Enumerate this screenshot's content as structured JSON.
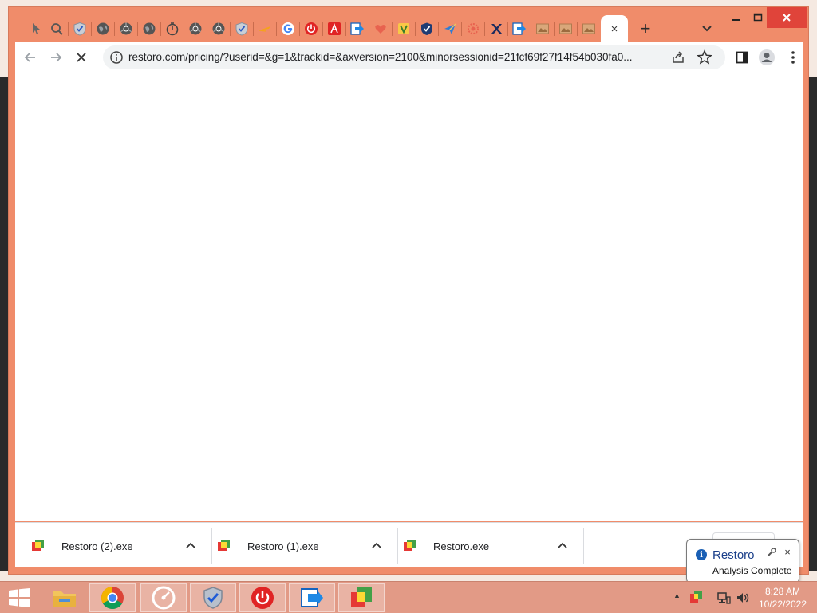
{
  "browser": {
    "url": "restoro.com/pricing/?userid=&g=1&trackid=&axversion=2100&minorsessionid=21fcf69f27f14f54b030fa0...",
    "tabs": [
      {
        "icon": "pointer-icon"
      },
      {
        "icon": "search-icon"
      },
      {
        "icon": "shield-check-icon"
      },
      {
        "icon": "globe-icon"
      },
      {
        "icon": "chrome-icon"
      },
      {
        "icon": "globe-icon"
      },
      {
        "icon": "timer-icon"
      },
      {
        "icon": "chrome-icon"
      },
      {
        "icon": "chrome-icon"
      },
      {
        "icon": "shield-check-icon"
      },
      {
        "icon": "plane-icon"
      },
      {
        "icon": "google-icon"
      },
      {
        "icon": "power-icon"
      },
      {
        "icon": "adobe-icon"
      },
      {
        "icon": "arrow-box-icon"
      },
      {
        "icon": "heart-icon"
      },
      {
        "icon": "yellow-app-icon"
      },
      {
        "icon": "shield-icon"
      },
      {
        "icon": "paper-plane-icon"
      },
      {
        "icon": "gear-icon"
      },
      {
        "icon": "x-icon"
      },
      {
        "icon": "arrow-box-icon"
      },
      {
        "icon": "image-icon"
      },
      {
        "icon": "image-icon"
      },
      {
        "icon": "image-icon"
      }
    ],
    "active_tab_close": "×",
    "new_tab": "+"
  },
  "downloads": [
    {
      "name": "Restoro (2).exe"
    },
    {
      "name": "Restoro (1).exe"
    },
    {
      "name": "Restoro.exe"
    }
  ],
  "notification": {
    "title": "Restoro",
    "message": "Analysis Complete",
    "close": "×"
  },
  "taskbar": {
    "apps": [
      {
        "name": "file-explorer-icon"
      },
      {
        "name": "chrome-icon"
      },
      {
        "name": "speedometer-icon"
      },
      {
        "name": "shield-check-icon"
      },
      {
        "name": "power-icon"
      },
      {
        "name": "arrow-box-icon"
      },
      {
        "name": "restoro-icon"
      }
    ],
    "time": "8:28 AM",
    "date": "10/22/2022"
  },
  "colors": {
    "browser_frame": "#f08c6a",
    "taskbar": "#e29a86",
    "close_button": "#e0443a"
  }
}
